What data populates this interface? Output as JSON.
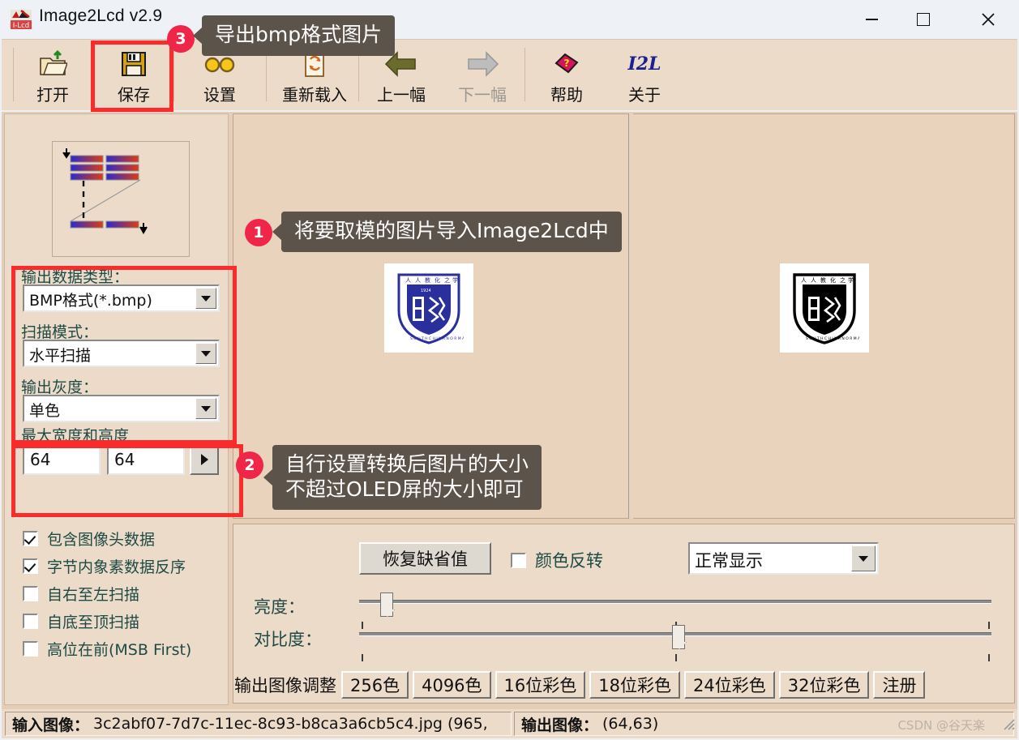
{
  "window": {
    "title": "Image2Lcd v2.9",
    "app_icon": "image2lcd-logo-icon",
    "minimize": "minimize-icon",
    "maximize": "maximize-icon",
    "close": "close-icon"
  },
  "toolbar": {
    "buttons": [
      {
        "label": "打开",
        "icon": "open-folder-icon",
        "disabled": false
      },
      {
        "label": "保存",
        "icon": "save-floppy-icon",
        "disabled": false
      },
      {
        "label": "设置",
        "icon": "glasses-settings-icon",
        "disabled": false
      },
      {
        "label": "重新载入",
        "icon": "reload-page-icon",
        "disabled": false
      },
      {
        "label": "上一幅",
        "icon": "arrow-left-icon",
        "disabled": false
      },
      {
        "label": "下一幅",
        "icon": "arrow-right-icon",
        "disabled": true
      },
      {
        "label": "帮助",
        "icon": "help-book-icon",
        "disabled": false
      },
      {
        "label": "关于",
        "icon": "i2l-logo-icon",
        "disabled": false
      }
    ]
  },
  "left_panel": {
    "scan_preview_icon": "scan-pattern-diagram",
    "output_type": {
      "label": "输出数据类型：",
      "value": "BMP格式(*.bmp)"
    },
    "scan_mode": {
      "label": "扫描模式：",
      "value": "水平扫描"
    },
    "output_gray": {
      "label": "输出灰度：",
      "value": "单色"
    },
    "max_size": {
      "label": "最大宽度和高度",
      "width": "64",
      "height": "64",
      "apply_icon": "play-arrow-icon"
    },
    "checkboxes": [
      {
        "label": "包含图像头数据",
        "checked": true
      },
      {
        "label": "字节内象素数据反序",
        "checked": true
      },
      {
        "label": "自右至左扫描",
        "checked": false
      },
      {
        "label": "自底至顶扫描",
        "checked": false
      },
      {
        "label": "高位在前(MSB First)",
        "checked": false
      }
    ]
  },
  "preview": {
    "input_logo_icon": "university-crest-blue",
    "output_logo_icon": "university-crest-mono"
  },
  "adjust_panel": {
    "restore_defaults": "恢复缺省值",
    "invert_color": {
      "label": "颜色反转",
      "checked": false
    },
    "display_mode": "正常显示",
    "brightness_label": "亮度：",
    "contrast_label": "对比度：",
    "brightness_value": 4,
    "contrast_value": 50,
    "tabs_label": "输出图像调整",
    "color_tabs": [
      "256色",
      "4096色",
      "16位彩色",
      "18位彩色",
      "24位彩色",
      "32位彩色",
      "注册"
    ]
  },
  "statusbar": {
    "input_label": "输入图像：",
    "input_value": "3c2abf07-7d7c-11ec-8c93-b8ca3a6cb5c4.jpg (965,",
    "output_label": "输出图像：",
    "output_value": "(64,63)",
    "watermark": "CSDN @谷天楽"
  },
  "annotations": {
    "callout1": {
      "badge": "1",
      "text": "将要取模的图片导入Image2Lcd中"
    },
    "callout2": {
      "badge": "2",
      "text": "自行设置转换后图片的大小\n不超过OLED屏的大小即可"
    },
    "callout3": {
      "badge": "3",
      "text": "导出bmp格式图片"
    },
    "highlight_color": "#fc2b2b",
    "callout_bg": "#5c534a",
    "badge_bg": "#f02648"
  }
}
